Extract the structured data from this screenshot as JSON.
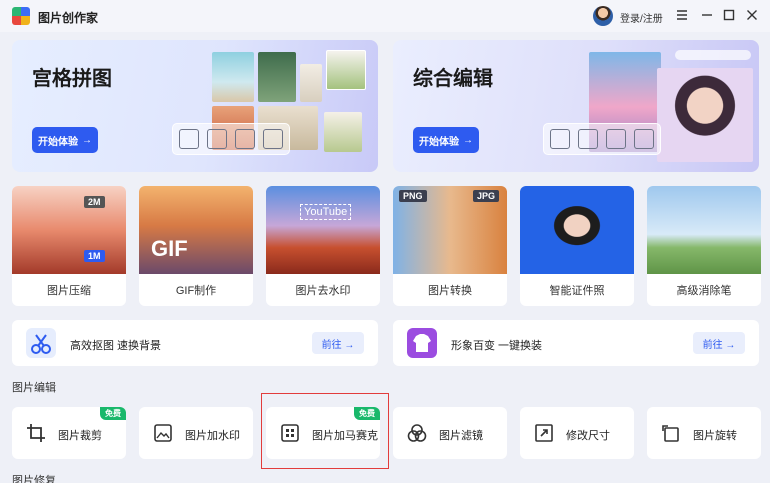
{
  "app": {
    "title": "图片创作家",
    "login": "登录/注册"
  },
  "banners": [
    {
      "title": "宫格拼图",
      "button": "开始体验",
      "arrow": "→"
    },
    {
      "title": "综合编辑",
      "button": "开始体验",
      "arrow": "→"
    }
  ],
  "cards": [
    {
      "label": "图片压缩",
      "size_top": "2M",
      "size_bottom": "1M"
    },
    {
      "label": "GIF制作",
      "overlay": "GIF"
    },
    {
      "label": "图片去水印",
      "overlay": "YouTube"
    },
    {
      "label": "图片转换",
      "badge_left": "PNG",
      "badge_right": "JPG"
    },
    {
      "label": "智能证件照"
    },
    {
      "label": "高级消除笔"
    }
  ],
  "wide_actions": [
    {
      "label": "高效抠图 速换背景",
      "button": "前往 →"
    },
    {
      "label": "形象百变 一键换装",
      "button": "前往 →"
    }
  ],
  "section": {
    "title": "图片编辑",
    "next_title": "图片修复"
  },
  "tools": [
    {
      "label": "图片裁剪",
      "badge": "免费"
    },
    {
      "label": "图片加水印",
      "badge": ""
    },
    {
      "label": "图片加马赛克",
      "badge": "免费"
    },
    {
      "label": "图片滤镜",
      "badge": ""
    },
    {
      "label": "修改尺寸",
      "badge": ""
    },
    {
      "label": "图片旋转",
      "badge": ""
    }
  ],
  "colors": {
    "accent": "#2e5bf0",
    "free_badge": "#19b86b",
    "highlight": "#e23c3c"
  }
}
